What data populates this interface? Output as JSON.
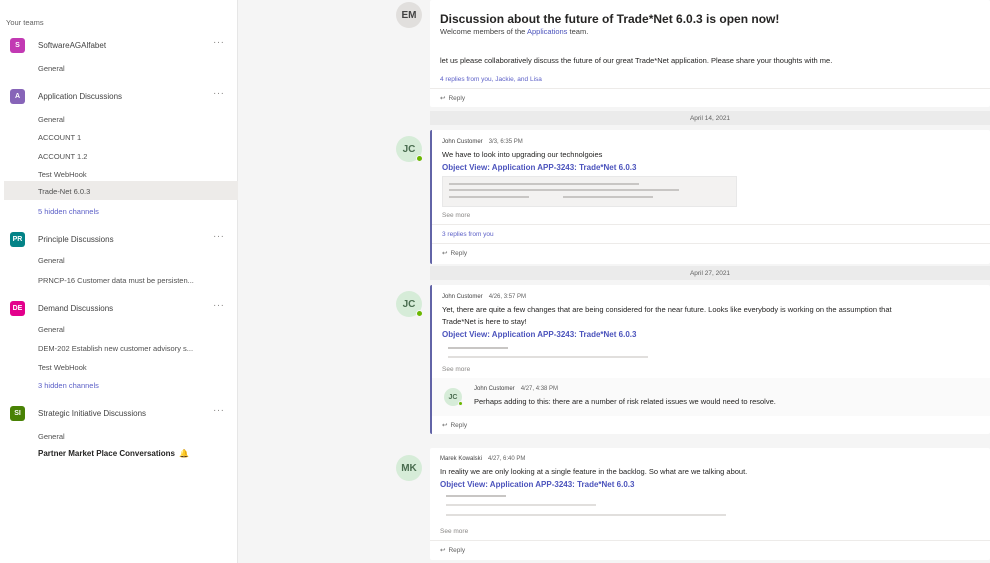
{
  "sidebar": {
    "heading": "Your teams",
    "teams": [
      {
        "initial": "S",
        "name": "SoftwareAGAlfabet",
        "color": "#c239b3",
        "more": "···",
        "channels": [
          "General"
        ]
      },
      {
        "initial": "A",
        "name": "Application Discussions",
        "color": "#8764b8",
        "more": "···",
        "channels": [
          "General",
          "ACCOUNT 1",
          "ACCOUNT 1.2",
          "Test WebHook",
          "Trade-Net 6.0.3"
        ],
        "hidden": "5 hidden channels"
      },
      {
        "initial": "PR",
        "name": "Principle Discussions",
        "color": "#038387",
        "more": "···",
        "channels": [
          "General",
          "PRNCP-16 Customer data must be persisten..."
        ]
      },
      {
        "initial": "DE",
        "name": "Demand Discussions",
        "color": "#e3008c",
        "more": "···",
        "channels": [
          "General",
          "DEM-202 Establish new customer advisory s...",
          "Test WebHook"
        ],
        "hidden": "3 hidden channels"
      },
      {
        "initial": "SI",
        "name": "Strategic Initiative Discussions",
        "color": "#498205",
        "more": "···",
        "channels": [
          "General"
        ]
      }
    ],
    "partner": "Partner Market Place Conversations",
    "partner_icon": "bell-icon",
    "partner_icon_glyph": "🔔"
  },
  "main": {
    "post1": {
      "avatar": "EM",
      "title": "Discussion about the future of Trade*Net 6.0.3 is open now!",
      "welcome_pre": "Welcome members of the ",
      "welcome_link": "Applications",
      "welcome_post": " team.",
      "body": "let us please collaboratively discuss the future of our great Trade*Net application. Please share your thoughts with me.",
      "replies": "4 replies from you, Jackie, and Lisa",
      "reply": "Reply"
    },
    "date1": "April 14, 2021",
    "post2": {
      "avatar": "JC",
      "author": "John Customer",
      "time": "3/3, 6:35 PM",
      "body": "We have to look into upgrading our technolgoies",
      "link_title": "Object View: Application APP-3243: Trade*Net 6.0.3",
      "see_more": "See more",
      "replies": "3 replies from you",
      "reply": "Reply"
    },
    "date2": "April 27, 2021",
    "post3": {
      "avatar": "JC",
      "author": "John Customer",
      "time": "4/26, 3:57 PM",
      "body1": "Yet, there are quite a few changes that are being considered for the near future. Looks like everybody is working on the assumption that",
      "body2": "Trade*Net is here to stay!",
      "link_title": "Object View: Application APP-3243: Trade*Net 6.0.3",
      "see_more": "See more",
      "nested": {
        "avatar": "JC",
        "author": "John Customer",
        "time": "4/27, 4:38 PM",
        "body": "Perhaps adding to this: there are a number of risk related issues we would need to resolve."
      },
      "reply": "Reply"
    },
    "post4": {
      "avatar": "MK",
      "author": "Marek Kowalski",
      "time": "4/27, 6:40 PM",
      "body": "In reality we are only looking at a single feature in the backlog. So what are we talking about.",
      "link_title": "Object View: Application APP-3243: Trade*Net 6.0.3",
      "see_more": "See more",
      "reply": "Reply"
    }
  }
}
